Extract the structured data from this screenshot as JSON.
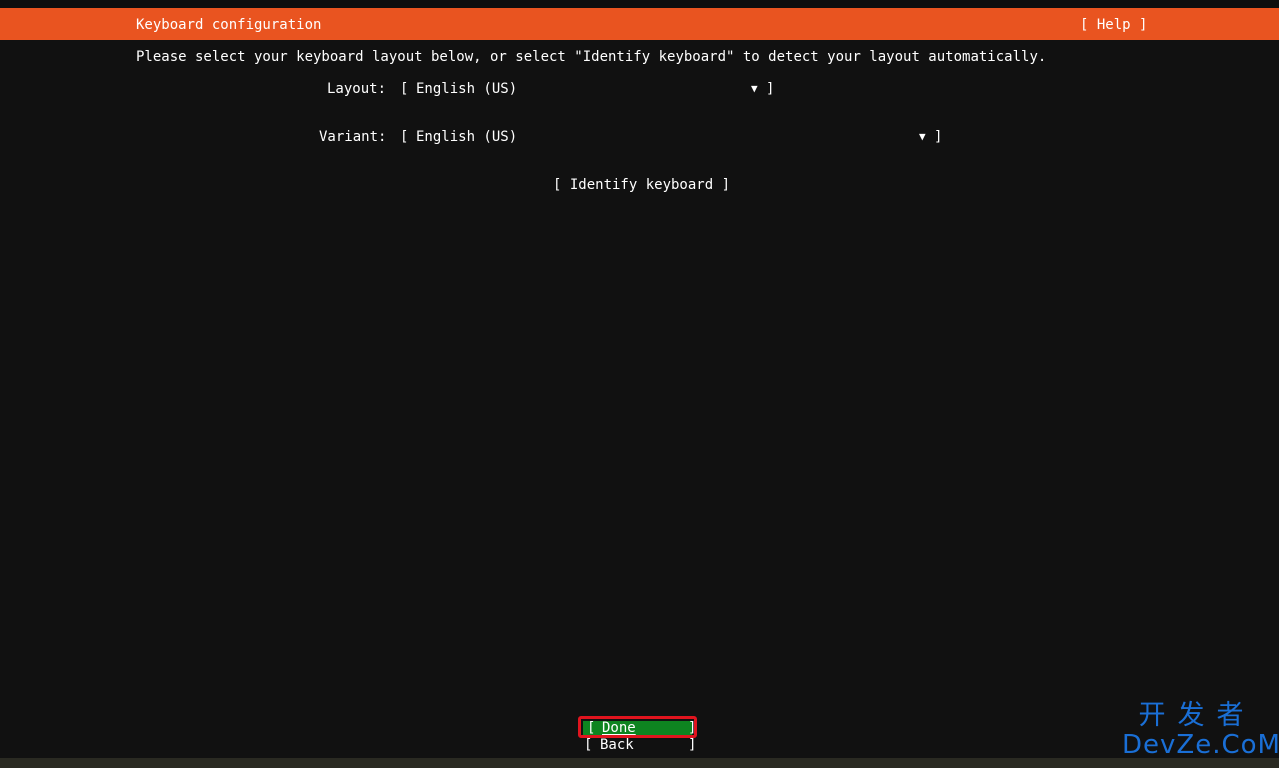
{
  "header": {
    "title": "Keyboard configuration",
    "help_label": "[ Help ]"
  },
  "colors": {
    "header_bg": "#e95420",
    "background": "#111111",
    "selected_button_bg": "#0e8420",
    "focus_outline": "#e0141e",
    "watermark": "#1a6fd6"
  },
  "instructions": "Please select your keyboard layout below, or select \"Identify keyboard\" to detect your layout automatically.",
  "form": {
    "layout": {
      "label": "Layout:",
      "value": "English (US)",
      "open_bracket": "[",
      "close_bracket": "]",
      "arrow": "▼"
    },
    "variant": {
      "label": "Variant:",
      "value": "English (US)",
      "open_bracket": "[",
      "close_bracket": "]",
      "arrow": "▼"
    },
    "identify_label": "[ Identify keyboard ]"
  },
  "buttons": {
    "done": {
      "open_bracket": "[",
      "label": "Done",
      "close_bracket": "]"
    },
    "back": {
      "open_bracket": "[",
      "label": "Back",
      "close_bracket": "]"
    }
  },
  "watermark": {
    "line1": "开发者",
    "line2": "DevZe.CoM"
  }
}
